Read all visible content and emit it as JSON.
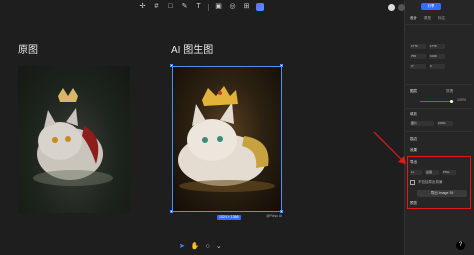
{
  "toolbar": {
    "icons": [
      "move-icon",
      "frame-icon",
      "shape-icon",
      "pen-icon",
      "text-icon",
      "image-icon",
      "component-icon",
      "plugin-icon",
      "ai-icon"
    ]
  },
  "canvas": {
    "label_original": "原图",
    "label_ai": "AI 图生图",
    "image_dims": "1024 × 1366",
    "watermark": "@Pixso AI"
  },
  "panel": {
    "share_label": "分享",
    "tabs": [
      "设计",
      "原型",
      "标注"
    ],
    "props": {
      "x": "1776",
      "y": "1776",
      "w": "756",
      "h": "1029",
      "rotation": "0°",
      "radius": "0"
    },
    "layer_title": "图层",
    "pass_through": "穿透",
    "opacity": "100%",
    "fill_title": "填充",
    "fill_type": "图片",
    "fill_pct": "100%",
    "stroke_title": "描边",
    "effects_title": "效果",
    "export_title": "导出",
    "export_scale": "1x",
    "export_suffix": "后缀",
    "export_format": "PNG",
    "export_checkbox": "不包括导出背景",
    "export_button": "导出 Image 39",
    "preview_label": "预览",
    "help": "?"
  },
  "bottom_tools": [
    "cursor-icon",
    "hand-icon",
    "comment-icon"
  ]
}
